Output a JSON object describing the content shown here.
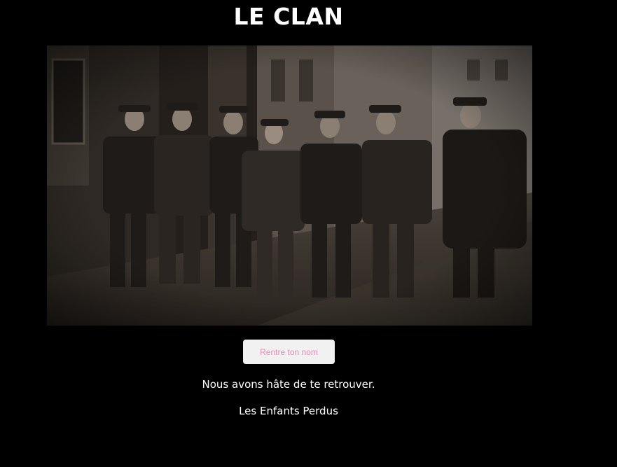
{
  "header": {
    "title": "LE CLAN"
  },
  "image": {
    "description_icon": "group-photo"
  },
  "form": {
    "button_label": "Rentre ton nom"
  },
  "messages": {
    "line1": "Nous avons hâte de te retrouver.",
    "line2": "Les Enfants Perdus"
  },
  "colors": {
    "background": "#000000",
    "button_background": "#f1f1f1",
    "button_text": "#e98ab4",
    "text": "#ffffff"
  }
}
